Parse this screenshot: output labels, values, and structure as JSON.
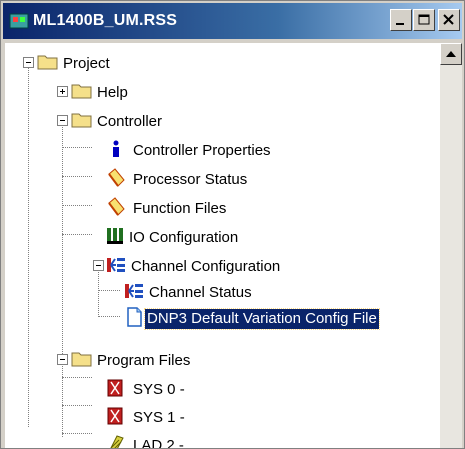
{
  "window": {
    "title": "ML1400B_UM.RSS"
  },
  "tree": {
    "project": "Project",
    "help": "Help",
    "controller": "Controller",
    "controller_properties": "Controller Properties",
    "processor_status": "Processor Status",
    "function_files": "Function Files",
    "io_configuration": "IO Configuration",
    "channel_configuration": "Channel Configuration",
    "channel_status": "Channel Status",
    "dnp3_config": "DNP3 Default Variation Config File",
    "program_files": "Program Files",
    "sys0": "SYS 0 -",
    "sys1": "SYS 1 -",
    "lad2": "LAD 2 -"
  },
  "colors": {
    "selection": "#0a246a",
    "titlebar": "#0a246a",
    "folder": "#f5e08a"
  }
}
